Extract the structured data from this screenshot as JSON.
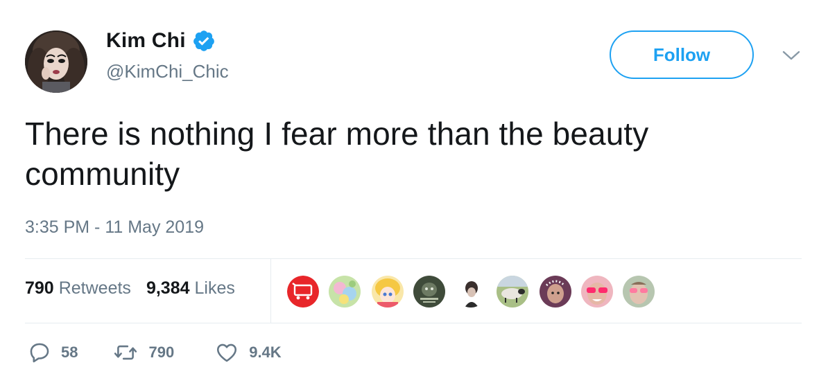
{
  "author": {
    "display_name": "Kim Chi",
    "handle": "@KimChi_Chic",
    "verified": true,
    "verified_icon": "verified-badge-icon"
  },
  "header": {
    "follow_label": "Follow",
    "more_icon": "chevron-down-icon"
  },
  "tweet": {
    "text": "There is nothing I fear more than the beauty community",
    "timestamp": "3:35 PM - 11 May 2019"
  },
  "stats": {
    "retweets_count": "790",
    "retweets_label": "Retweets",
    "likes_count": "9,384",
    "likes_label": "Likes"
  },
  "actions": {
    "reply_count": "58",
    "retweet_count": "790",
    "like_count": "9.4K",
    "reply_icon": "reply-icon",
    "retweet_icon": "retweet-icon",
    "like_icon": "heart-icon"
  },
  "colors": {
    "brand_blue": "#1da1f2",
    "text_primary": "#14171a",
    "text_secondary": "#657786",
    "divider": "#e6ecf0"
  }
}
